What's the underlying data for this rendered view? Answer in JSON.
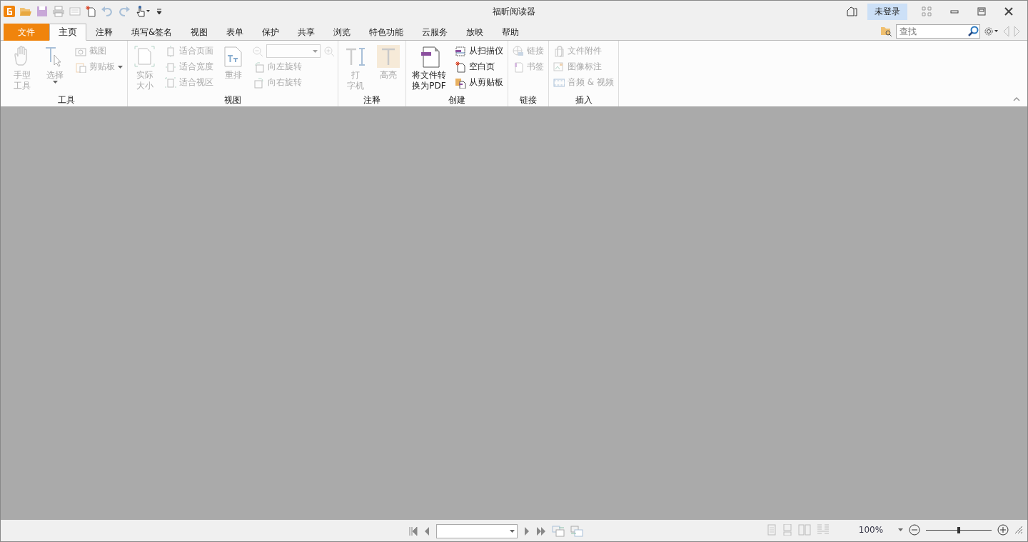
{
  "window": {
    "title": "福昕阅读器"
  },
  "account_button": "未登录",
  "tabs": [
    {
      "label": "文件",
      "kind": "file",
      "selected": false
    },
    {
      "label": "主页",
      "kind": "tab",
      "selected": true
    },
    {
      "label": "注释",
      "kind": "tab",
      "selected": false
    },
    {
      "label": "填写&签名",
      "kind": "tab",
      "selected": false
    },
    {
      "label": "视图",
      "kind": "tab",
      "selected": false
    },
    {
      "label": "表单",
      "kind": "tab",
      "selected": false
    },
    {
      "label": "保护",
      "kind": "tab",
      "selected": false
    },
    {
      "label": "共享",
      "kind": "tab",
      "selected": false
    },
    {
      "label": "浏览",
      "kind": "tab",
      "selected": false
    },
    {
      "label": "特色功能",
      "kind": "tab",
      "selected": false
    },
    {
      "label": "云服务",
      "kind": "tab",
      "selected": false
    },
    {
      "label": "放映",
      "kind": "tab",
      "selected": false
    },
    {
      "label": "帮助",
      "kind": "tab",
      "selected": false
    }
  ],
  "search": {
    "placeholder": "查找"
  },
  "ribbon": {
    "groups": [
      {
        "label": "工具",
        "columns": [
          {
            "kind": "large",
            "items": [
              {
                "label_lines": [
                  "手型",
                  "工具"
                ],
                "disabled": true,
                "active": false
              }
            ]
          },
          {
            "kind": "large",
            "items": [
              {
                "label_lines": [
                  "选择"
                ],
                "disabled": true,
                "active": false,
                "dropdown": true
              }
            ]
          },
          {
            "kind": "small",
            "items": [
              {
                "label": "截图",
                "disabled": true
              },
              {
                "label": "剪贴板",
                "disabled": true,
                "dropdown": true
              }
            ]
          }
        ]
      },
      {
        "label": "视图",
        "columns": [
          {
            "kind": "large",
            "items": [
              {
                "label_lines": [
                  "实际",
                  "大小"
                ],
                "disabled": true,
                "active": false
              }
            ]
          },
          {
            "kind": "small",
            "items": [
              {
                "label": "适合页面",
                "disabled": true
              },
              {
                "label": "适合宽度",
                "disabled": true
              },
              {
                "label": "适合视区",
                "disabled": true
              }
            ]
          },
          {
            "kind": "large",
            "items": [
              {
                "label_lines": [
                  "重排"
                ],
                "disabled": true,
                "active": false
              }
            ]
          },
          {
            "kind": "small",
            "items": [
              {
                "kind": "zoom-combo",
                "disabled": true
              },
              {
                "label": "向左旋转",
                "disabled": true
              },
              {
                "label": "向右旋转",
                "disabled": true
              }
            ]
          }
        ]
      },
      {
        "label": "注释",
        "columns": [
          {
            "kind": "large",
            "items": [
              {
                "label_lines": [
                  "打",
                  "字机"
                ],
                "disabled": true,
                "active": false
              }
            ]
          },
          {
            "kind": "large",
            "items": [
              {
                "label_lines": [
                  "高亮"
                ],
                "disabled": true,
                "active": true
              }
            ]
          }
        ]
      },
      {
        "label": "创建",
        "columns": [
          {
            "kind": "large",
            "items": [
              {
                "label_lines": [
                  "将文件转",
                  "换为PDF"
                ],
                "disabled": false,
                "active": false
              }
            ]
          },
          {
            "kind": "small",
            "items": [
              {
                "label": "从扫描仪",
                "disabled": false
              },
              {
                "label": "空白页",
                "disabled": false
              },
              {
                "label": "从剪贴板",
                "disabled": false
              }
            ]
          }
        ]
      },
      {
        "label": "链接",
        "columns": [
          {
            "kind": "small",
            "items": [
              {
                "label": "链接",
                "disabled": true
              },
              {
                "label": "书签",
                "disabled": true
              }
            ]
          }
        ]
      },
      {
        "label": "插入",
        "columns": [
          {
            "kind": "small",
            "items": [
              {
                "label": "文件附件",
                "disabled": true
              },
              {
                "label": "图像标注",
                "disabled": true
              },
              {
                "label": "音频 & 视频",
                "disabled": true
              }
            ]
          }
        ]
      }
    ]
  },
  "status_bar": {
    "zoom": "100%",
    "zoom_slider": {
      "level": 0.5
    }
  }
}
